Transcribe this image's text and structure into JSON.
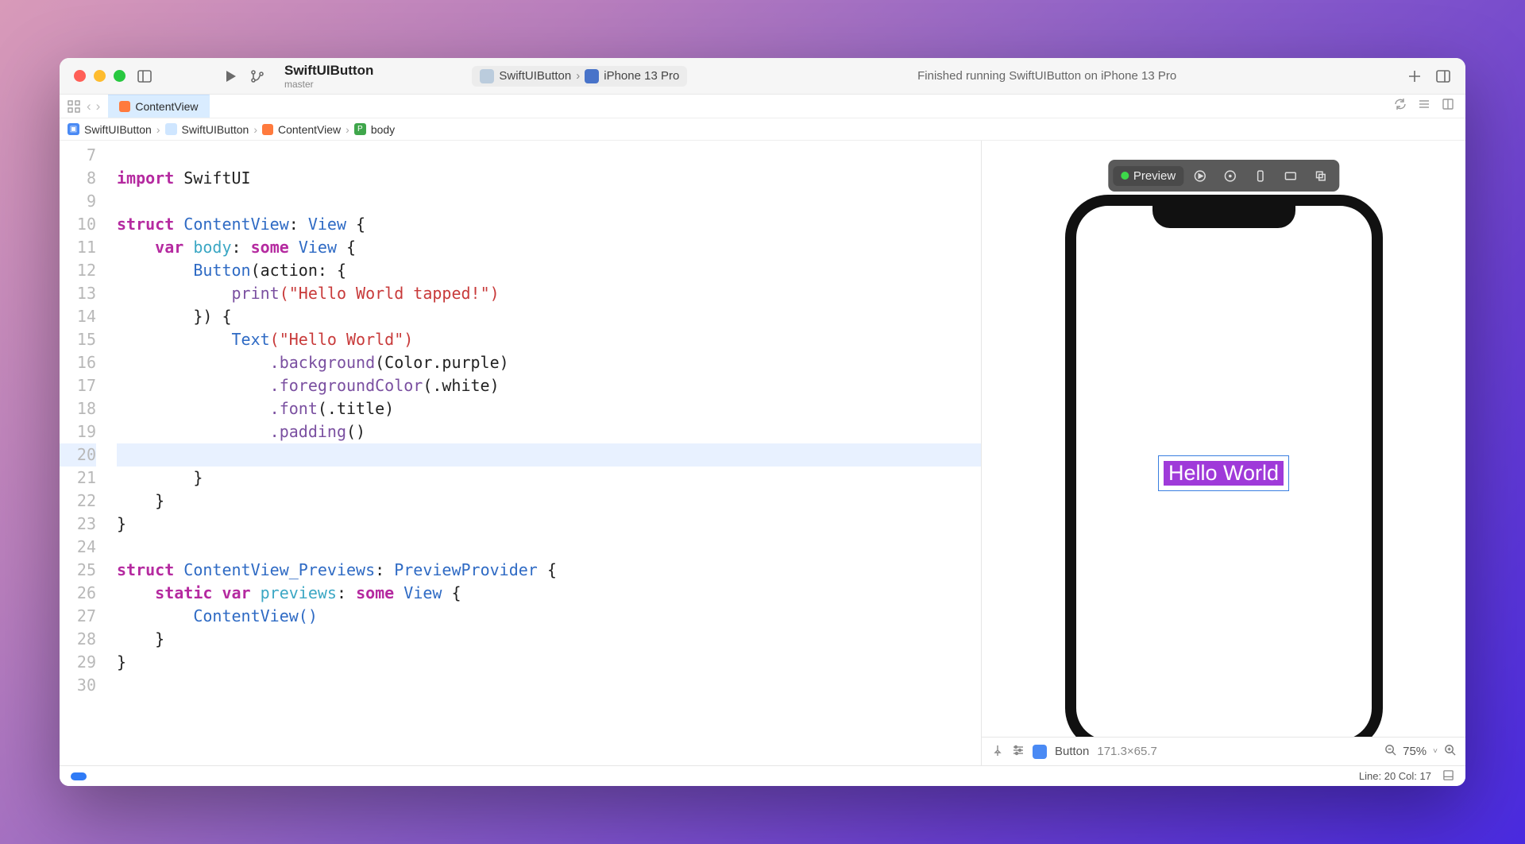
{
  "project": {
    "name": "SwiftUIButton",
    "branch": "master"
  },
  "scheme": {
    "target": "SwiftUIButton",
    "device": "iPhone 13 Pro"
  },
  "statusMessage": "Finished running SwiftUIButton on iPhone 13 Pro",
  "tab": {
    "filename": "ContentView"
  },
  "breadcrumb": {
    "project": "SwiftUIButton",
    "folder": "SwiftUIButton",
    "file": "ContentView",
    "symbol": "body"
  },
  "code": {
    "lineNumbers": [
      "7",
      "8",
      "9",
      "10",
      "11",
      "12",
      "13",
      "14",
      "15",
      "16",
      "17",
      "18",
      "19",
      "20",
      "21",
      "22",
      "23",
      "24",
      "25",
      "26",
      "27",
      "28",
      "29",
      "30"
    ],
    "lines": {
      "l7": "",
      "import": "import",
      "swiftui": "SwiftUI",
      "struct": "struct",
      "ContentView": "ContentView",
      "View": "View",
      "var": "var",
      "body": "body",
      "some": "some",
      "Button": "Button",
      "action": "(action: {",
      "print": "print",
      "printArg": "(\"Hello World tapped!\")",
      "closeAct": "}) {",
      "Text": "Text",
      "textArg": "(\"Hello World\")",
      "bg": ".background",
      "bgArg": "(Color.purple)",
      "fg": ".foregroundColor",
      "fgArg": "(.white)",
      "font": ".font",
      "fontArg": "(.title)",
      "pad": ".padding",
      "padArg": "()",
      "close1": "        }",
      "close2": "    }",
      "close3": "}",
      "Previews": "ContentView_Previews",
      "PreviewProvider": "PreviewProvider",
      "static": "static",
      "previews": "previews",
      "ctor": "ContentView()"
    },
    "currentLine": 20
  },
  "preview": {
    "label": "Preview",
    "buttonText": "Hello World",
    "status": {
      "element": "Button",
      "dimensions": "171.3×65.7"
    },
    "zoom": "75%"
  },
  "bottom": {
    "position": "Line: 20  Col: 17"
  }
}
